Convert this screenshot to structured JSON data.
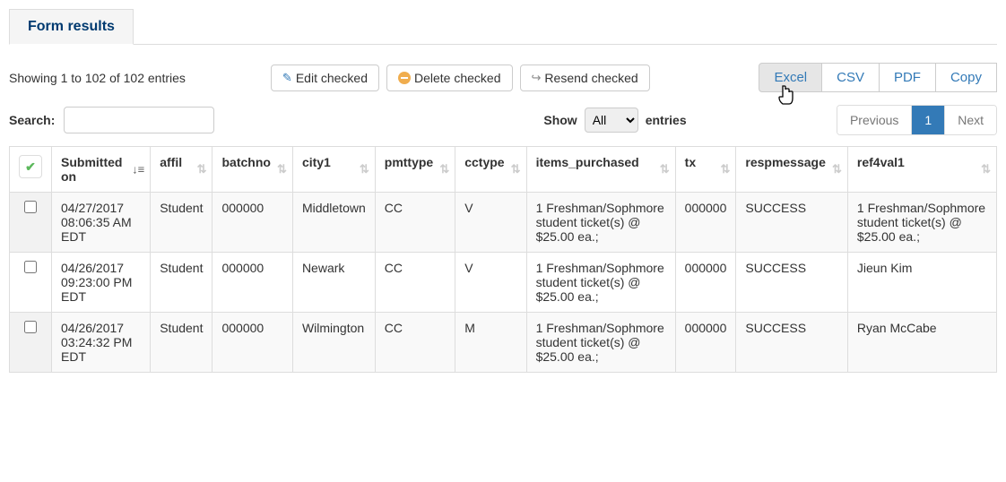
{
  "tab": {
    "title": "Form results"
  },
  "entries_text": "Showing 1 to 102 of 102 entries",
  "toolbar": {
    "edit_label": "Edit checked",
    "delete_label": "Delete checked",
    "resend_label": "Resend checked"
  },
  "export": {
    "excel": "Excel",
    "csv": "CSV",
    "pdf": "PDF",
    "copy": "Copy"
  },
  "search": {
    "label": "Search:",
    "value": ""
  },
  "show": {
    "label_pre": "Show",
    "label_post": "entries",
    "value": "All"
  },
  "pagination": {
    "previous": "Previous",
    "page": "1",
    "next": "Next"
  },
  "columns": [
    "Submitted on",
    "affil",
    "batchno",
    "city1",
    "pmttype",
    "cctype",
    "items_purchased",
    "tx",
    "respmessage",
    "ref4val1"
  ],
  "rows": [
    {
      "submitted_on": "04/27/2017 08:06:35 AM EDT",
      "affil": "Student",
      "batchno": "000000",
      "city1": "Middletown",
      "pmttype": "CC",
      "cctype": "V",
      "items_purchased": "1 Freshman/Sophmore student ticket(s) @ $25.00 ea.;",
      "tx": "000000",
      "respmessage": "SUCCESS",
      "ref4val1": "1 Freshman/Sophmore student ticket(s) @ $25.00 ea.;"
    },
    {
      "submitted_on": "04/26/2017 09:23:00 PM EDT",
      "affil": "Student",
      "batchno": "000000",
      "city1": "Newark",
      "pmttype": "CC",
      "cctype": "V",
      "items_purchased": "1 Freshman/Sophmore student ticket(s) @ $25.00 ea.;",
      "tx": "000000",
      "respmessage": "SUCCESS",
      "ref4val1": "Jieun Kim"
    },
    {
      "submitted_on": "04/26/2017 03:24:32 PM EDT",
      "affil": "Student",
      "batchno": "000000",
      "city1": "Wilmington",
      "pmttype": "CC",
      "cctype": "M",
      "items_purchased": "1 Freshman/Sophmore student ticket(s) @ $25.00 ea.;",
      "tx": "000000",
      "respmessage": "SUCCESS",
      "ref4val1": "Ryan McCabe"
    }
  ]
}
